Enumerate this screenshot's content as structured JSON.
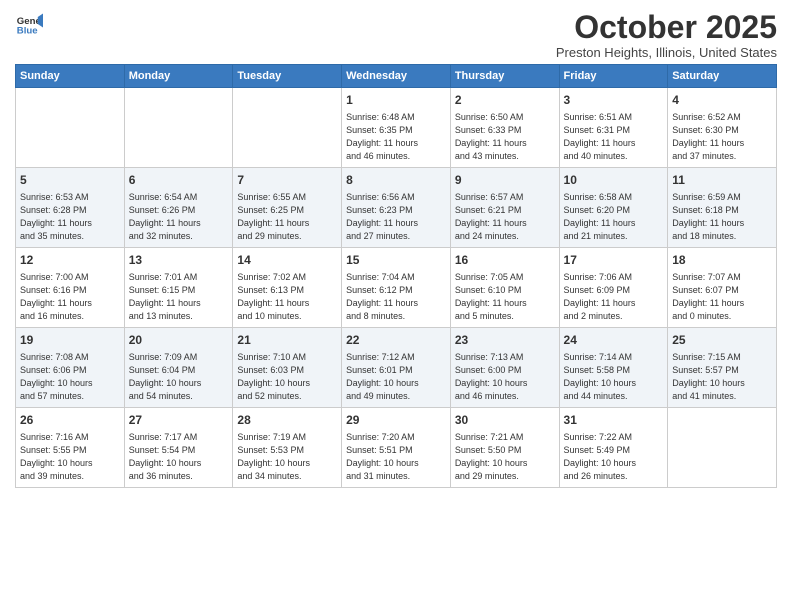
{
  "header": {
    "logo_line1": "General",
    "logo_line2": "Blue",
    "month": "October 2025",
    "location": "Preston Heights, Illinois, United States"
  },
  "weekdays": [
    "Sunday",
    "Monday",
    "Tuesday",
    "Wednesday",
    "Thursday",
    "Friday",
    "Saturday"
  ],
  "weeks": [
    [
      {
        "day": "",
        "info": ""
      },
      {
        "day": "",
        "info": ""
      },
      {
        "day": "",
        "info": ""
      },
      {
        "day": "1",
        "info": "Sunrise: 6:48 AM\nSunset: 6:35 PM\nDaylight: 11 hours\nand 46 minutes."
      },
      {
        "day": "2",
        "info": "Sunrise: 6:50 AM\nSunset: 6:33 PM\nDaylight: 11 hours\nand 43 minutes."
      },
      {
        "day": "3",
        "info": "Sunrise: 6:51 AM\nSunset: 6:31 PM\nDaylight: 11 hours\nand 40 minutes."
      },
      {
        "day": "4",
        "info": "Sunrise: 6:52 AM\nSunset: 6:30 PM\nDaylight: 11 hours\nand 37 minutes."
      }
    ],
    [
      {
        "day": "5",
        "info": "Sunrise: 6:53 AM\nSunset: 6:28 PM\nDaylight: 11 hours\nand 35 minutes."
      },
      {
        "day": "6",
        "info": "Sunrise: 6:54 AM\nSunset: 6:26 PM\nDaylight: 11 hours\nand 32 minutes."
      },
      {
        "day": "7",
        "info": "Sunrise: 6:55 AM\nSunset: 6:25 PM\nDaylight: 11 hours\nand 29 minutes."
      },
      {
        "day": "8",
        "info": "Sunrise: 6:56 AM\nSunset: 6:23 PM\nDaylight: 11 hours\nand 27 minutes."
      },
      {
        "day": "9",
        "info": "Sunrise: 6:57 AM\nSunset: 6:21 PM\nDaylight: 11 hours\nand 24 minutes."
      },
      {
        "day": "10",
        "info": "Sunrise: 6:58 AM\nSunset: 6:20 PM\nDaylight: 11 hours\nand 21 minutes."
      },
      {
        "day": "11",
        "info": "Sunrise: 6:59 AM\nSunset: 6:18 PM\nDaylight: 11 hours\nand 18 minutes."
      }
    ],
    [
      {
        "day": "12",
        "info": "Sunrise: 7:00 AM\nSunset: 6:16 PM\nDaylight: 11 hours\nand 16 minutes."
      },
      {
        "day": "13",
        "info": "Sunrise: 7:01 AM\nSunset: 6:15 PM\nDaylight: 11 hours\nand 13 minutes."
      },
      {
        "day": "14",
        "info": "Sunrise: 7:02 AM\nSunset: 6:13 PM\nDaylight: 11 hours\nand 10 minutes."
      },
      {
        "day": "15",
        "info": "Sunrise: 7:04 AM\nSunset: 6:12 PM\nDaylight: 11 hours\nand 8 minutes."
      },
      {
        "day": "16",
        "info": "Sunrise: 7:05 AM\nSunset: 6:10 PM\nDaylight: 11 hours\nand 5 minutes."
      },
      {
        "day": "17",
        "info": "Sunrise: 7:06 AM\nSunset: 6:09 PM\nDaylight: 11 hours\nand 2 minutes."
      },
      {
        "day": "18",
        "info": "Sunrise: 7:07 AM\nSunset: 6:07 PM\nDaylight: 11 hours\nand 0 minutes."
      }
    ],
    [
      {
        "day": "19",
        "info": "Sunrise: 7:08 AM\nSunset: 6:06 PM\nDaylight: 10 hours\nand 57 minutes."
      },
      {
        "day": "20",
        "info": "Sunrise: 7:09 AM\nSunset: 6:04 PM\nDaylight: 10 hours\nand 54 minutes."
      },
      {
        "day": "21",
        "info": "Sunrise: 7:10 AM\nSunset: 6:03 PM\nDaylight: 10 hours\nand 52 minutes."
      },
      {
        "day": "22",
        "info": "Sunrise: 7:12 AM\nSunset: 6:01 PM\nDaylight: 10 hours\nand 49 minutes."
      },
      {
        "day": "23",
        "info": "Sunrise: 7:13 AM\nSunset: 6:00 PM\nDaylight: 10 hours\nand 46 minutes."
      },
      {
        "day": "24",
        "info": "Sunrise: 7:14 AM\nSunset: 5:58 PM\nDaylight: 10 hours\nand 44 minutes."
      },
      {
        "day": "25",
        "info": "Sunrise: 7:15 AM\nSunset: 5:57 PM\nDaylight: 10 hours\nand 41 minutes."
      }
    ],
    [
      {
        "day": "26",
        "info": "Sunrise: 7:16 AM\nSunset: 5:55 PM\nDaylight: 10 hours\nand 39 minutes."
      },
      {
        "day": "27",
        "info": "Sunrise: 7:17 AM\nSunset: 5:54 PM\nDaylight: 10 hours\nand 36 minutes."
      },
      {
        "day": "28",
        "info": "Sunrise: 7:19 AM\nSunset: 5:53 PM\nDaylight: 10 hours\nand 34 minutes."
      },
      {
        "day": "29",
        "info": "Sunrise: 7:20 AM\nSunset: 5:51 PM\nDaylight: 10 hours\nand 31 minutes."
      },
      {
        "day": "30",
        "info": "Sunrise: 7:21 AM\nSunset: 5:50 PM\nDaylight: 10 hours\nand 29 minutes."
      },
      {
        "day": "31",
        "info": "Sunrise: 7:22 AM\nSunset: 5:49 PM\nDaylight: 10 hours\nand 26 minutes."
      },
      {
        "day": "",
        "info": ""
      }
    ]
  ]
}
